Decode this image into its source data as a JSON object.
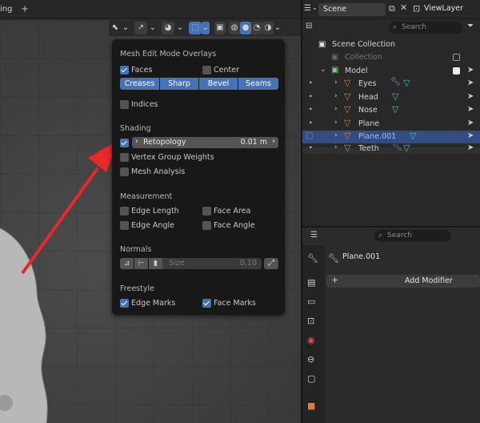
{
  "topbar": {
    "left_partial": "ing",
    "plus_icon": "plus-icon"
  },
  "header": {
    "scene_label": "Scene",
    "view_layer_label": "ViewLayer"
  },
  "overlay_popup": {
    "title": "Mesh Edit Mode Overlays",
    "faces_label": "Faces",
    "faces_checked": true,
    "center_label": "Center",
    "center_checked": false,
    "edge_buttons": [
      "Creases",
      "Sharp",
      "Bevel",
      "Seams"
    ],
    "indices_label": "Indices",
    "shading_heading": "Shading",
    "retopology_label": "Retopology",
    "retopology_value": "0.01 m",
    "retopology_checked": true,
    "vertex_group_label": "Vertex Group Weights",
    "mesh_analysis_label": "Mesh Analysis",
    "measurement_heading": "Measurement",
    "edge_length_label": "Edge Length",
    "face_area_label": "Face Area",
    "edge_angle_label": "Edge Angle",
    "face_angle_label": "Face Angle",
    "normals_heading": "Normals",
    "size_label": "Size",
    "size_value": "0.10",
    "freestyle_heading": "Freestyle",
    "edge_marks_label": "Edge Marks",
    "edge_marks_checked": true,
    "face_marks_label": "Face Marks",
    "face_marks_checked": true
  },
  "outliner": {
    "search_placeholder": "Search",
    "scene_collection": "Scene Collection",
    "collection": "Collection",
    "model": "Model",
    "items": [
      "Eyes",
      "Head",
      "Nose",
      "Plane",
      "Plane.001",
      "Teeth"
    ],
    "selected_item": "Plane.001"
  },
  "properties": {
    "search_placeholder": "Search",
    "object_name": "Plane.001",
    "add_modifier_label": "Add Modifier"
  },
  "colors": {
    "accent": "#4772b3",
    "arrow": "#e8282b",
    "mesh_icon": "#e07a3f",
    "modifier_icon": "#48c0c8"
  }
}
